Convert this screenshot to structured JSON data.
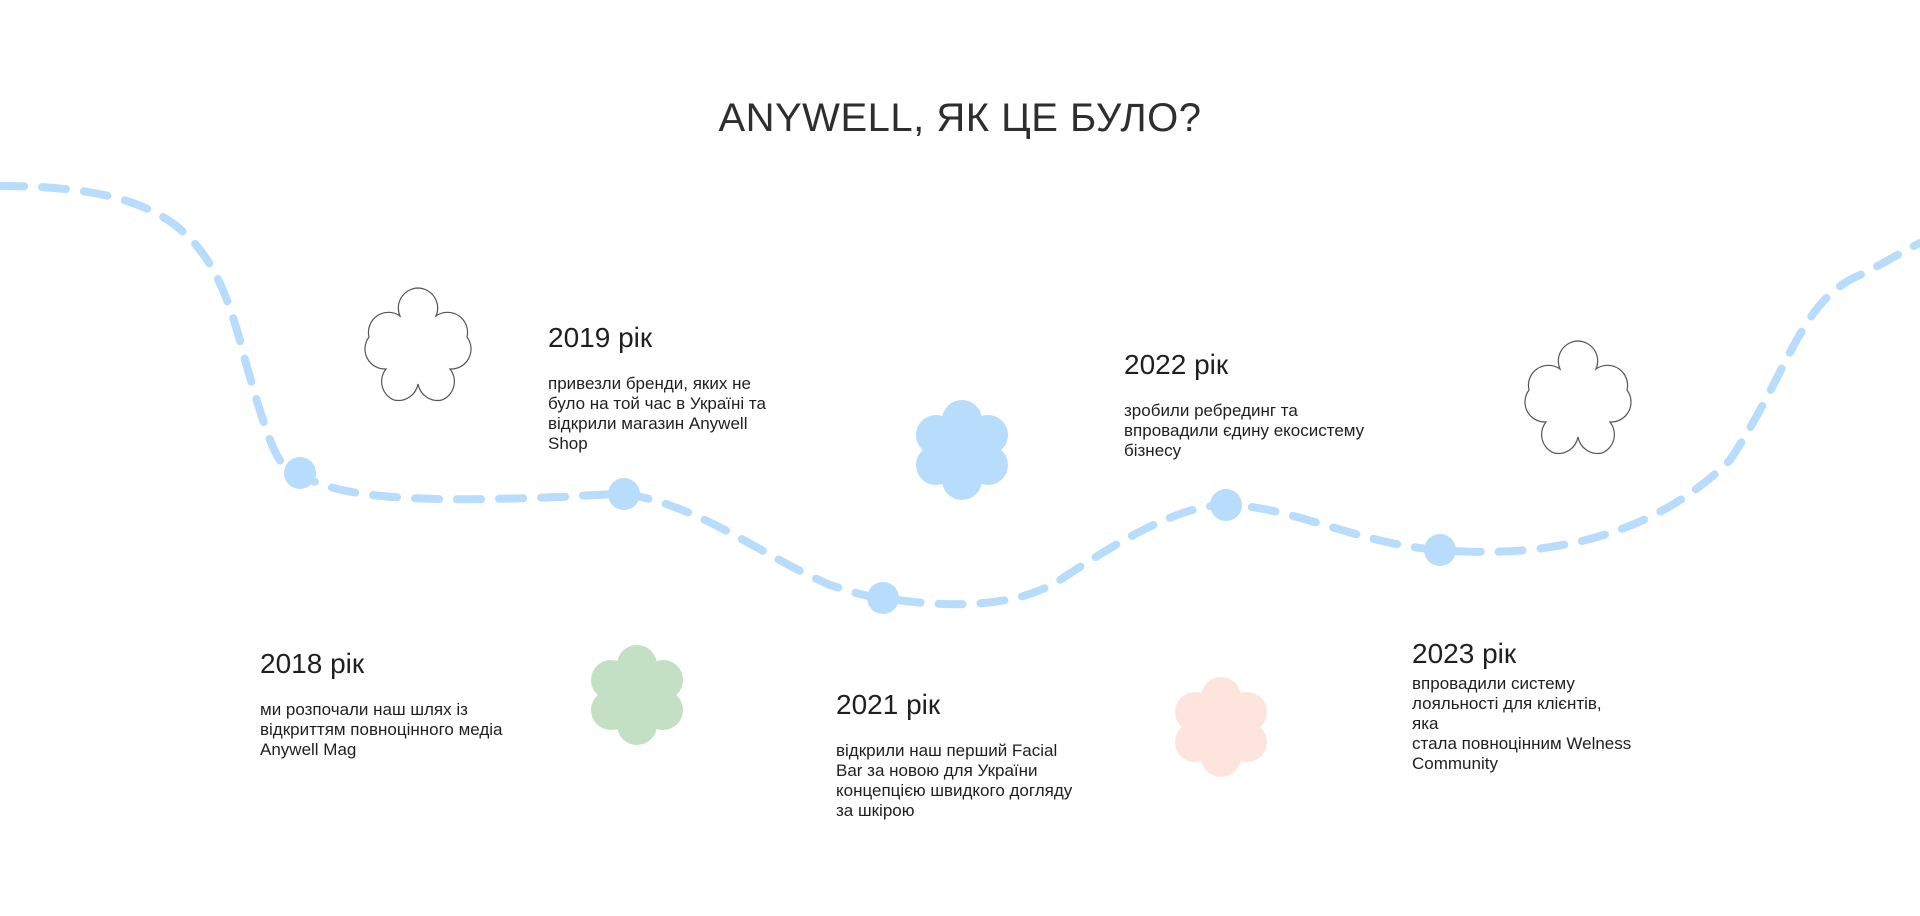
{
  "page": {
    "title": "ANYWELL, ЯК ЦЕ БУЛО?"
  },
  "colors": {
    "path": "#b7dcfc",
    "dot": "#b7dcfc",
    "flower_blue": "#b7dcfc",
    "flower_green": "#c3dfc4",
    "flower_peach": "#fde5dd",
    "flower_outline": "#555555"
  },
  "icons": [
    "flower-outline-icon",
    "flower-blue-icon",
    "flower-green-icon",
    "flower-peach-icon"
  ],
  "milestones": [
    {
      "year": "2018 рік",
      "description": "ми розпочали наш шлях із\nвідкриттям повноцінного медіа\nAnywell Mag"
    },
    {
      "year": "2019 рік",
      "description": "привезли бренди, яких не\nбуло на той час в Україні та\nвідкрили магазин Anywell\nShop"
    },
    {
      "year": "2021 рік",
      "description": "відкрили наш перший Facial\nBar за новою для України\nконцепцією швидкого догляду\nза шкірою"
    },
    {
      "year": "2022 рік",
      "description": "зробили ребрединг та\nвпровадили єдину екосистему\nбізнесу"
    },
    {
      "year": "2023 рік",
      "description": "впровадили систему\nлояльності для клієнтів,\nяка\nстала повноцінним Welness\nCommunity"
    }
  ]
}
